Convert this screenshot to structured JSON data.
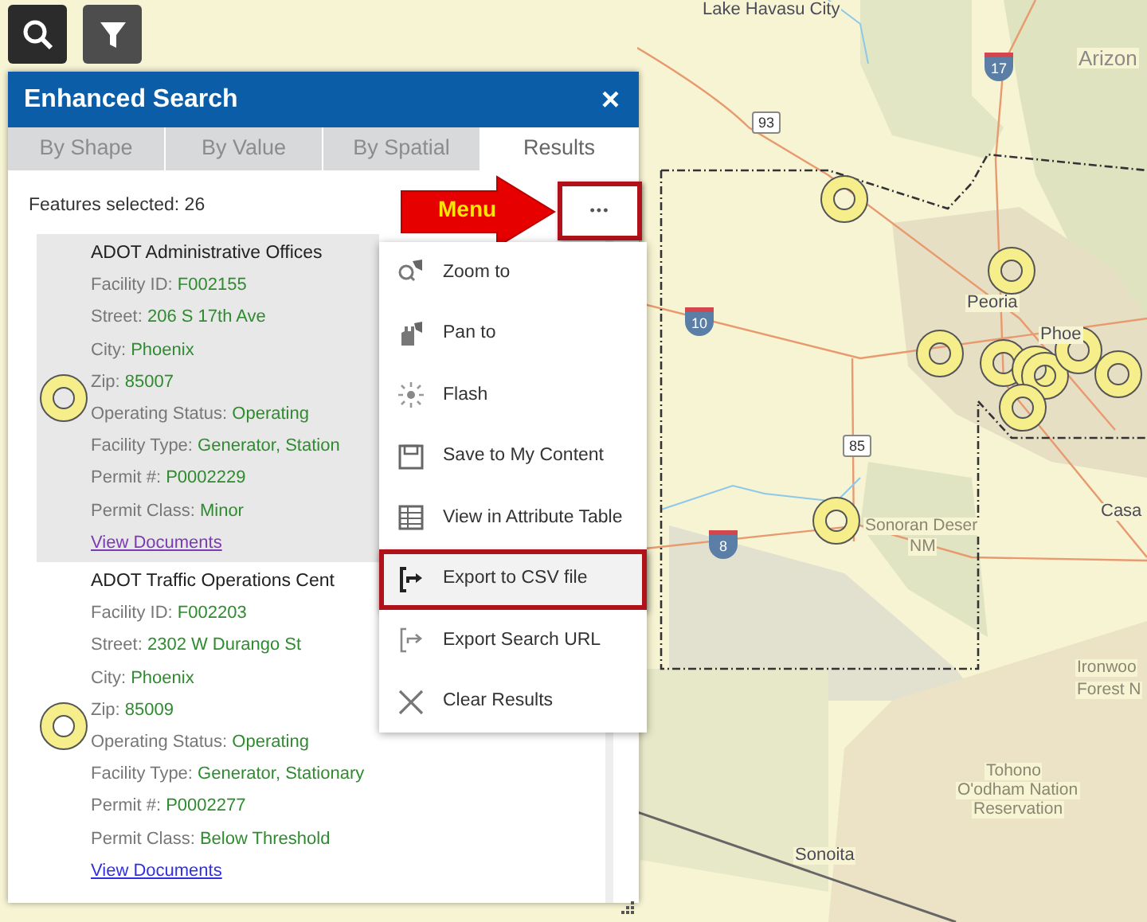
{
  "toolbar": {
    "buttons": [
      {
        "kind": "search"
      },
      {
        "kind": "filter"
      }
    ]
  },
  "map": {
    "labels": [
      {
        "text": "Lake Havasu City",
        "kind": "city"
      },
      {
        "text": "Arizon",
        "kind": "region"
      },
      {
        "text": "Peoria",
        "kind": "city"
      },
      {
        "text": "Phoe",
        "kind": "city"
      },
      {
        "text": "Sonoran Deser",
        "kind": "park"
      },
      {
        "text": "NM",
        "kind": "park"
      },
      {
        "text": "Casa",
        "kind": "city"
      },
      {
        "text": "Ironwoo",
        "kind": "park"
      },
      {
        "text": "Forest N",
        "kind": "park"
      },
      {
        "text": "Tohono",
        "kind": "park"
      },
      {
        "text": "O'odham Nation",
        "kind": "park"
      },
      {
        "text": "Reservation",
        "kind": "park"
      },
      {
        "text": "Sonoita",
        "kind": "city"
      }
    ],
    "shields": [
      {
        "number": "17",
        "kind": "interstate"
      },
      {
        "number": "93",
        "kind": "us"
      },
      {
        "number": "10",
        "kind": "interstate"
      },
      {
        "number": "85",
        "kind": "us"
      },
      {
        "number": "8",
        "kind": "interstate"
      }
    ]
  },
  "panel": {
    "title": "Enhanced Search",
    "close": "×",
    "tabs": [
      {
        "label": "By Shape",
        "selected": false
      },
      {
        "label": "By Value",
        "selected": false
      },
      {
        "label": "By Spatial",
        "selected": false
      },
      {
        "label": "Results",
        "selected": true
      }
    ],
    "features_selected": "Features selected: 26",
    "menu_button": "•••",
    "results": [
      {
        "title": "ADOT Administrative Offices",
        "selected": true,
        "fields": [
          {
            "label": "Facility ID:",
            "value": "F002155"
          },
          {
            "label": "Street:",
            "value": "206 S 17th Ave"
          },
          {
            "label": "City:",
            "value": "Phoenix"
          },
          {
            "label": "Zip:",
            "value": "85007"
          },
          {
            "label": "Operating Status:",
            "value": "Operating"
          },
          {
            "label": "Facility Type:",
            "value": "Generator, Station"
          },
          {
            "label": "Permit #:",
            "value": "P0002229"
          },
          {
            "label": "Permit Class:",
            "value": "Minor"
          }
        ],
        "link": "View Documents",
        "visited": true
      },
      {
        "title": "ADOT Traffic Operations Cent",
        "selected": false,
        "fields": [
          {
            "label": "Facility ID:",
            "value": "F002203"
          },
          {
            "label": "Street:",
            "value": "2302 W Durango St"
          },
          {
            "label": "City:",
            "value": "Phoenix"
          },
          {
            "label": "Zip:",
            "value": "85009"
          },
          {
            "label": "Operating Status:",
            "value": "Operating"
          },
          {
            "label": "Facility Type:",
            "value": "Generator, Stationary"
          },
          {
            "label": "Permit #:",
            "value": "P0002277"
          },
          {
            "label": "Permit Class:",
            "value": "Below Threshold"
          }
        ],
        "link": "View Documents",
        "visited": false
      }
    ]
  },
  "menu": {
    "items": [
      {
        "label": "Zoom to",
        "kind": "zoom",
        "highlighted": false
      },
      {
        "label": "Pan to",
        "kind": "pan",
        "highlighted": false
      },
      {
        "label": "Flash",
        "kind": "flash",
        "highlighted": false
      },
      {
        "label": "Save to My Content",
        "kind": "save",
        "highlighted": false
      },
      {
        "label": "View in Attribute Table",
        "kind": "table",
        "highlighted": false
      },
      {
        "label": "Export to CSV file",
        "kind": "export",
        "highlighted": true
      },
      {
        "label": "Export Search URL",
        "kind": "export-url",
        "highlighted": false
      },
      {
        "label": "Clear Results",
        "kind": "clear",
        "highlighted": false
      }
    ]
  },
  "callout": {
    "label": "Menu"
  }
}
